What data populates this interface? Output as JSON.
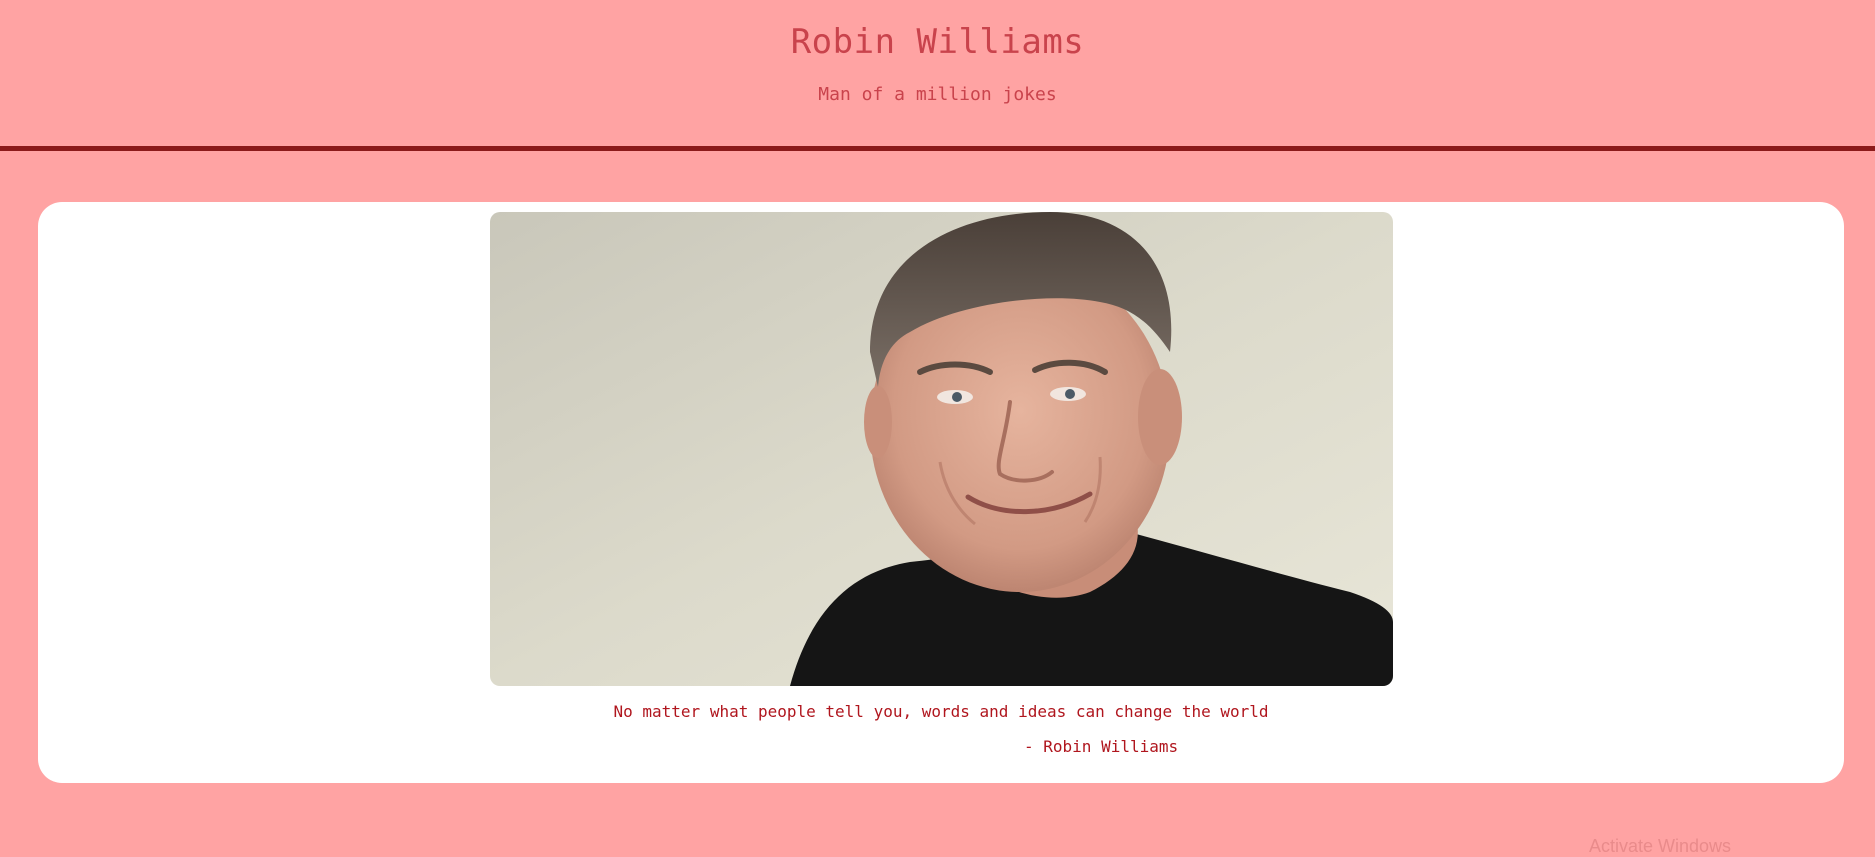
{
  "header": {
    "title": "Robin Williams",
    "subtitle": "Man of a million jokes"
  },
  "tribute": {
    "image_alt": "Portrait photo of Robin Williams",
    "quote": "No matter what people tell you, words and ideas can change the world",
    "author": "- Robin Williams"
  },
  "system": {
    "watermark": "Activate Windows"
  },
  "colors": {
    "page_background": "#ffa3a3",
    "accent_text": "#c9434c",
    "quote_text": "#b0161e",
    "header_rule": "#8b1a1a",
    "card_background": "#ffffff"
  }
}
